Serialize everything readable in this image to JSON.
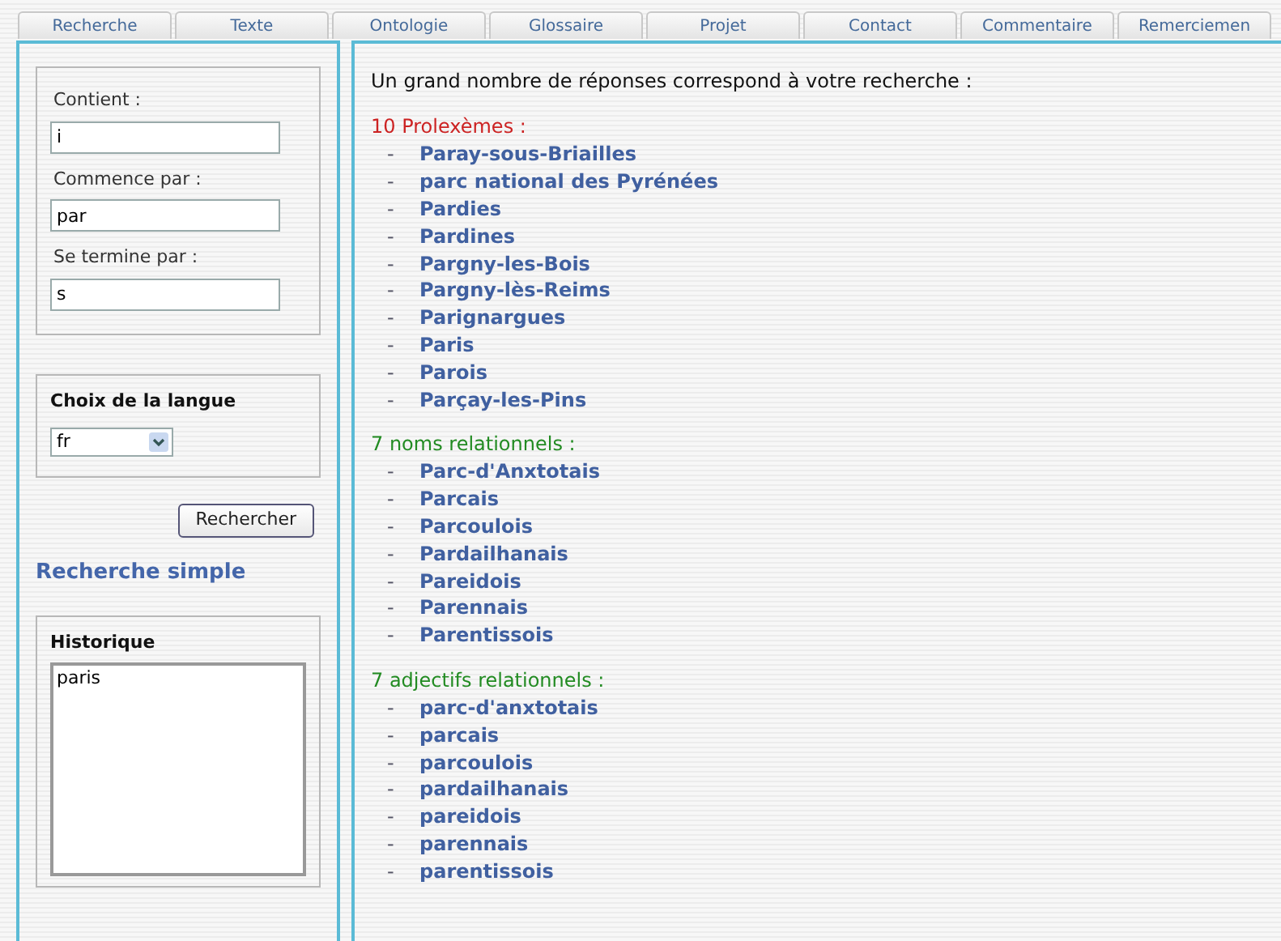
{
  "tabs": [
    {
      "label": "Recherche",
      "selected": false
    },
    {
      "label": "Texte",
      "selected": false
    },
    {
      "label": "Ontologie",
      "selected": false
    },
    {
      "label": "Glossaire",
      "selected": false
    },
    {
      "label": "Projet",
      "selected": false
    },
    {
      "label": "Contact",
      "selected": false
    },
    {
      "label": "Commentaire",
      "selected": false
    },
    {
      "label": "Remerciemen",
      "selected": false
    }
  ],
  "filters": [
    {
      "label": "Contient :",
      "value": "i"
    },
    {
      "label": "Commence par :",
      "value": "par"
    },
    {
      "label": "Se termine par :",
      "value": "s"
    }
  ],
  "language": {
    "title": "Choix de la langue",
    "value": "fr"
  },
  "search_button": "Rechercher",
  "simple_link": "Recherche simple",
  "history": {
    "title": "Historique",
    "items": [
      "paris"
    ]
  },
  "results": {
    "heading": "Un grand nombre de réponses correspond à votre recherche :",
    "groups": [
      {
        "label": "10 Prolexèmes :",
        "color": "#cc2222",
        "items": [
          {
            "marker": "-",
            "text": "Paray-sous-Briailles"
          },
          {
            "marker": "-",
            "text": "parc national des Pyrénées"
          },
          {
            "marker": "-",
            "text": "Pardies"
          },
          {
            "marker": "-",
            "text": "Pardines"
          },
          {
            "marker": "-",
            "text": "Pargny-les-Bois"
          },
          {
            "marker": "-",
            "text": "Pargny-lès-Reims"
          },
          {
            "marker": "-",
            "text": "Parignargues"
          },
          {
            "marker": "-",
            "text": "Paris"
          },
          {
            "marker": "-",
            "text": "Parois"
          },
          {
            "marker": "-",
            "text": "Parçay-les-Pins"
          }
        ]
      },
      {
        "label": "7 noms relationnels :",
        "color": "#228b22",
        "items": [
          {
            "marker": "-",
            "text": "Parc-d'Anxtotais"
          },
          {
            "marker": "-",
            "text": "Parcais"
          },
          {
            "marker": "-",
            "text": "Parcoulois"
          },
          {
            "marker": "-",
            "text": "Pardailhanais"
          },
          {
            "marker": "-",
            "text": "Pareidois"
          },
          {
            "marker": "-",
            "text": "Parennais"
          },
          {
            "marker": "-",
            "text": "Parentissois"
          }
        ]
      },
      {
        "label": "7 adjectifs relationnels :",
        "color": "#228b22",
        "items": [
          {
            "marker": "-",
            "text": "parc-d'anxtotais"
          },
          {
            "marker": "-",
            "text": "parcais"
          },
          {
            "marker": "-",
            "text": "parcoulois"
          },
          {
            "marker": "-",
            "text": "pardailhanais"
          },
          {
            "marker": "-",
            "text": "pareidois"
          },
          {
            "marker": "-",
            "text": "parennais"
          },
          {
            "marker": "-",
            "text": "parentissois"
          }
        ]
      }
    ]
  }
}
